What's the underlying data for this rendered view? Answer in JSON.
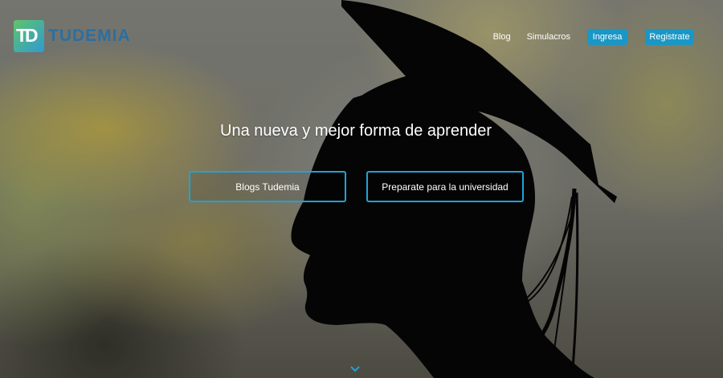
{
  "brand": {
    "logo_mark": "TD",
    "name": "TUDEMIA"
  },
  "nav": {
    "links": [
      "Blog",
      "Simulacros"
    ],
    "login_label": "Ingresa",
    "register_label": "Registrate"
  },
  "hero": {
    "headline": "Una nueva y mejor forma de aprender",
    "buttons": [
      "Blogs Tudemia",
      "Preparate para la universidad"
    ],
    "scroll_icon": "chevron-down-icon"
  },
  "colors": {
    "accent": "#1997c6",
    "cta_border": "#1ea3d8",
    "logo_text": "#2b6f9f"
  }
}
